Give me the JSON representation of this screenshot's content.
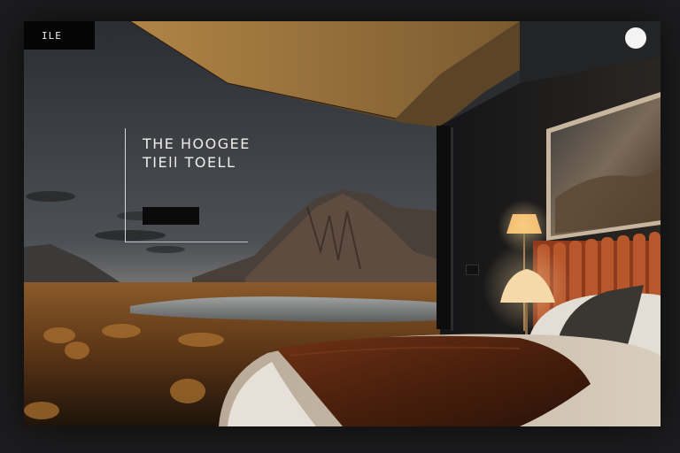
{
  "brand": {
    "logo": "ILE"
  },
  "nav": {
    "items": [
      "",
      "",
      "",
      "",
      "",
      ""
    ]
  },
  "top_right": {
    "line1": "",
    "link1": "",
    "link2": ""
  },
  "avatar": {
    "label": ""
  },
  "hero": {
    "eyebrow": "",
    "title_line1": "THE HOOGEE",
    "title_line2": "TIEll TOELL",
    "body": "",
    "cta_label": ""
  },
  "colors": {
    "accent_ceiling": "#a67a3e",
    "cta_bg": "#0a0a0a",
    "headboard": "#b0502a"
  }
}
